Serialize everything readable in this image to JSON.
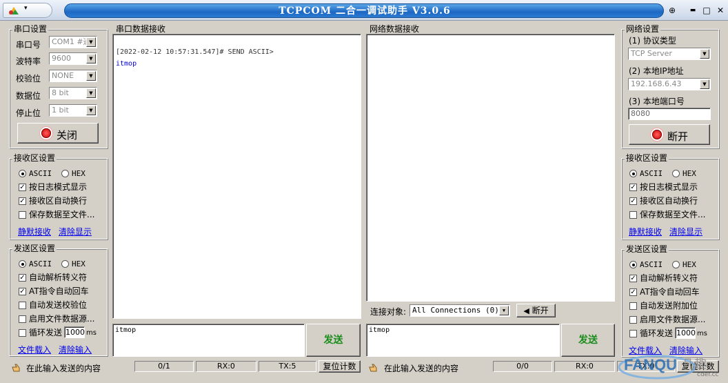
{
  "window": {
    "title": "TCPCOM 二合一调试助手  V3.0.6",
    "min": "▬",
    "restore": "□",
    "close": "✕",
    "pin": "⊕"
  },
  "serial": {
    "title": "串口设置",
    "port_label": "串口号",
    "port_value": "COM1 #通",
    "baud_label": "波特率",
    "baud_value": "9600",
    "parity_label": "校验位",
    "parity_value": "NONE",
    "databits_label": "数据位",
    "databits_value": "8 bit",
    "stopbits_label": "停止位",
    "stopbits_value": "1 bit",
    "close_button": "关闭"
  },
  "left_recv": {
    "title": "接收区设置",
    "ascii": "ASCII",
    "hex": "HEX",
    "opt1": "按日志模式显示",
    "opt2": "接收区自动换行",
    "opt3": "保存数据至文件...",
    "link1": "静默接收",
    "link2": "清除显示"
  },
  "left_send": {
    "title": "发送区设置",
    "ascii": "ASCII",
    "hex": "HEX",
    "opt1": "自动解析转义符",
    "opt2": "AT指令自动回车",
    "opt3": "自动发送校验位",
    "opt4": "启用文件数据源...",
    "opt5": "循环发送",
    "interval": "1000",
    "unit": "ms",
    "link1": "文件载入",
    "link2": "清除输入"
  },
  "serial_recv": {
    "title": "串口数据接收",
    "line1": "[2022-02-12 10:57:31.547]# SEND ASCII>",
    "line2": "itmop"
  },
  "serial_send": {
    "input": "itmop",
    "send": "发送"
  },
  "net_recv": {
    "title": "网络数据接收",
    "conn_label": "连接对象:",
    "conn_value": "All Connections (0)",
    "disconnect": "断开"
  },
  "net_send": {
    "input": "itmop",
    "send": "发送"
  },
  "network": {
    "title": "网络设置",
    "proto_label": "(1) 协议类型",
    "proto_value": "TCP Server",
    "ip_label": "(2) 本地IP地址",
    "ip_value": "192.168.6.43",
    "port_label": "(3) 本地端口号",
    "port_value": "8080",
    "open_button": "断开"
  },
  "right_recv": {
    "title": "接收区设置",
    "ascii": "ASCII",
    "hex": "HEX",
    "opt1": "按日志模式显示",
    "opt2": "接收区自动换行",
    "opt3": "保存数据至文件...",
    "link1": "静默接收",
    "link2": "清除显示"
  },
  "right_send": {
    "title": "发送区设置",
    "ascii": "ASCII",
    "hex": "HEX",
    "opt1": "自动解析转义符",
    "opt2": "AT指令自动回车",
    "opt3": "自动发送附加位",
    "opt4": "启用文件数据源...",
    "opt5": "循环发送",
    "interval": "1000",
    "unit": "ms",
    "link1": "文件载入",
    "link2": "清除输入"
  },
  "status_left": {
    "hint": "在此输入发送的内容",
    "count": "0/1",
    "rx": "RX:0",
    "tx": "TX:5",
    "reset": "复位计数"
  },
  "status_right": {
    "hint": "在此输入发送的内容",
    "count": "0/0",
    "rx": "RX:0",
    "tx": "TX:0",
    "reset": "复位计数"
  },
  "watermark": {
    "text": "FANQU",
    "sub": "凡趣",
    "domain": "cdef.cc"
  }
}
